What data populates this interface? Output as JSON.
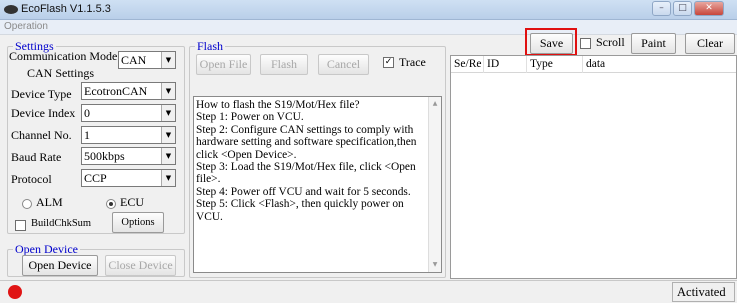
{
  "window": {
    "title": "EcoFlash V1.1.5.3",
    "controls": [
      "–",
      "□",
      "✕"
    ]
  },
  "menu": {
    "operation": "Operation"
  },
  "settings": {
    "title": "Settings",
    "comm_mode_label": "Communication Mode",
    "comm_mode_value": "CAN",
    "can_settings_title": "CAN Settings",
    "device_type_label": "Device Type",
    "device_type_value": "EcotronCAN",
    "device_index_label": "Device Index",
    "device_index_value": "0",
    "channel_label": "Channel No.",
    "channel_value": "1",
    "baud_label": "Baud Rate",
    "baud_value": "500kbps",
    "protocol_label": "Protocol",
    "protocol_value": "CCP",
    "alm_label": "ALM",
    "ecu_label": "ECU",
    "selected_target": "ECU",
    "buildchksum_label": "BuildChkSum",
    "options_label": "Options"
  },
  "open_device": {
    "title": "Open Device",
    "open_label": "Open Device",
    "close_label": "Close Device"
  },
  "flash": {
    "title": "Flash",
    "open_file_label": "Open File",
    "flash_label": "Flash",
    "cancel_label": "Cancel",
    "trace_label": "Trace",
    "trace_checked": true,
    "help_lines": [
      "How to flash the S19/Mot/Hex file?",
      "Step 1: Power on VCU.",
      "Step 2: Configure CAN settings to comply with hardware setting and software specification,then click <Open Device>.",
      "Step 3: Load the S19/Mot/Hex file, click <Open file>.",
      "Step 4: Power off VCU and wait for 5 seconds.",
      "Step 5: Click <Flash>, then quickly power on VCU."
    ]
  },
  "trace_panel": {
    "save_label": "Save",
    "scroll_label": "Scroll",
    "paint_label": "Paint",
    "clear_label": "Clear",
    "columns": [
      "Se/Re",
      "ID",
      "Type",
      "data"
    ]
  },
  "status": {
    "activated": "Activated",
    "indicator_color": "#e01414"
  },
  "icons": {
    "checkmark": "✓",
    "dropdown": "▼",
    "scroll_up": "▲",
    "scroll_down": "▼"
  }
}
